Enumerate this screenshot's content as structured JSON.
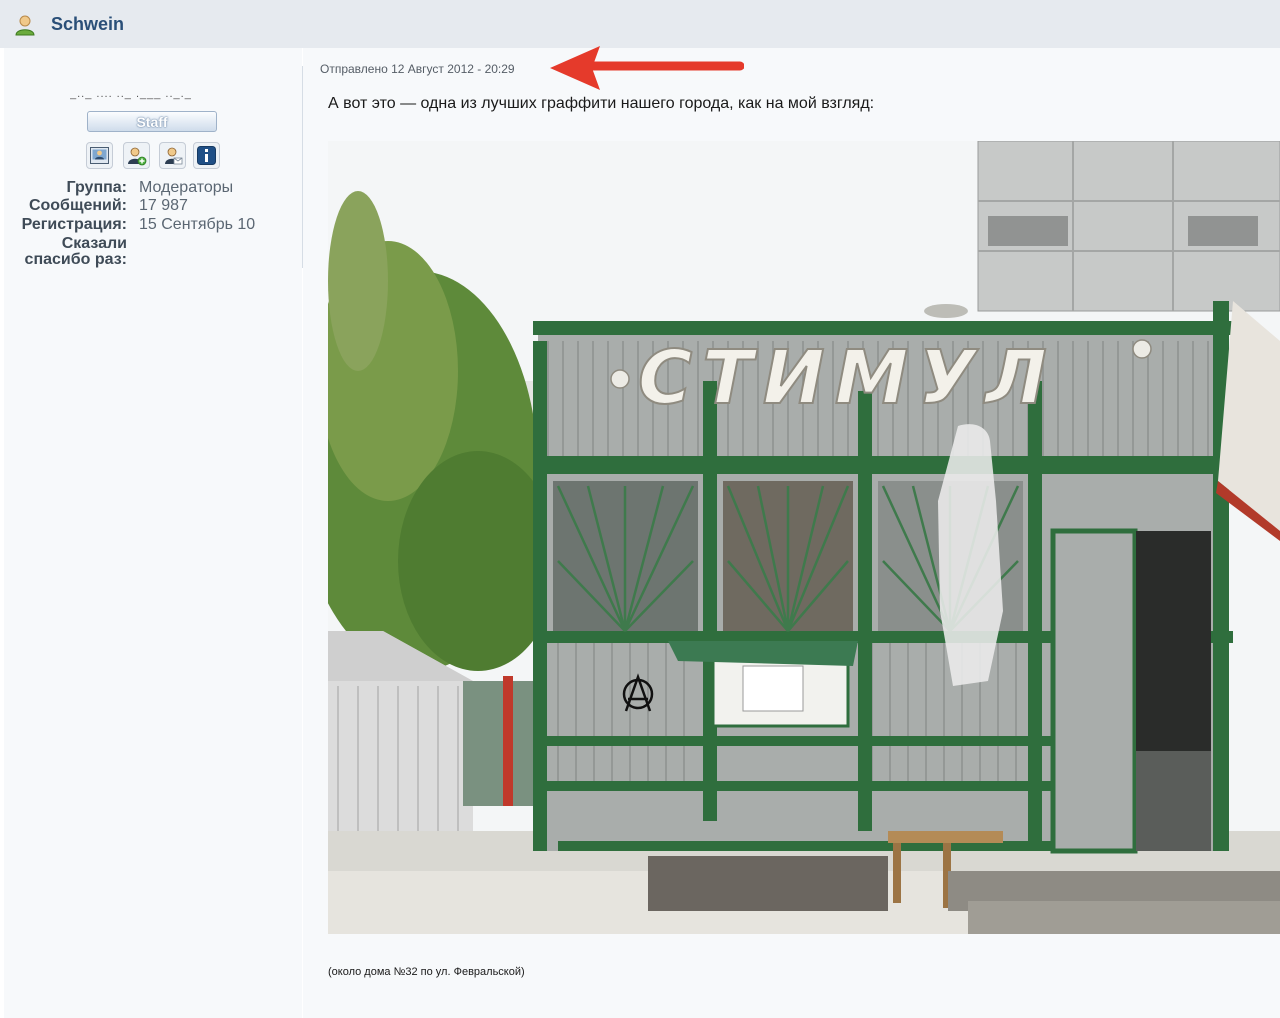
{
  "header": {
    "username": "Schwein"
  },
  "profile": {
    "title": "_.._ .... .._ .___ .._._",
    "badge": "Staff",
    "group_label": "Группа:",
    "group_value": "Модераторы",
    "posts_label": "Сообщений:",
    "posts_value": "17 987",
    "reg_label": "Регистрация:",
    "reg_value": "15 Сентябрь 10",
    "thanks_label_1": "Сказали",
    "thanks_label_2": "спасибо раз:"
  },
  "post": {
    "date": "Отправлено 12 Август 2012 - 20:29",
    "text": "А вот это — одна из лучших граффити нашего города, как на мой взгляд:",
    "image_sign": "СТИМУЛ",
    "caption": "(около дома №32 по ул. Февральской)"
  },
  "colors": {
    "header_bg": "#e6eaef",
    "username": "#2a4f78",
    "arrow": "#e53a2b",
    "kiosk_green": "#2f6e3d"
  },
  "icons": [
    "user-avatar-icon",
    "photo-icon",
    "add-friend-icon",
    "message-icon",
    "info-icon"
  ]
}
